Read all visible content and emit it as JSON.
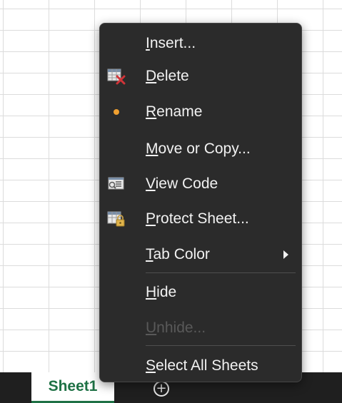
{
  "sheet_tabs": {
    "active_tab": "Sheet1",
    "add_sheet_symbol": "+"
  },
  "context_menu": {
    "items": [
      {
        "label": "Insert...",
        "mnemonic": "I",
        "icon": "none",
        "enabled": true
      },
      {
        "label": "Delete",
        "mnemonic": "D",
        "icon": "delete-sheet-icon",
        "enabled": true
      },
      {
        "label": "Rename",
        "mnemonic": "R",
        "icon": "rename-dot-icon",
        "enabled": true
      },
      {
        "label": "Move or Copy...",
        "mnemonic": "M",
        "icon": "none",
        "enabled": true
      },
      {
        "label": "View Code",
        "mnemonic": "V",
        "icon": "view-code-icon",
        "enabled": true
      },
      {
        "label": "Protect Sheet...",
        "mnemonic": "P",
        "icon": "protect-sheet-icon",
        "enabled": true
      },
      {
        "label": "Tab Color",
        "mnemonic": "T",
        "icon": "none",
        "enabled": true,
        "submenu": true
      },
      {
        "label": "Hide",
        "mnemonic": "H",
        "icon": "none",
        "enabled": true
      },
      {
        "label": "Unhide...",
        "mnemonic": "U",
        "icon": "none",
        "enabled": false
      },
      {
        "label": "Select All Sheets",
        "mnemonic": "S",
        "icon": "none",
        "enabled": true
      }
    ]
  },
  "colors": {
    "menu_background": "#2b2b2b",
    "menu_text": "#f2f2f2",
    "disabled_text": "#595959",
    "tab_accent": "#1e7145",
    "tabbar_background": "#1f1f1f"
  }
}
